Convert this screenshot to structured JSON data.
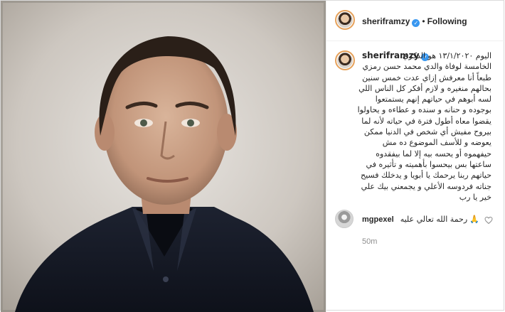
{
  "header": {
    "username": "sheriframzy",
    "verified_mark": "✓",
    "separator": "•",
    "follow_status": "Following"
  },
  "post": {
    "caption_username": "sheriframzy",
    "caption_lines": [
      "اليوم ١٣/١/٢٠٢٠ هو الذكري",
      "الخامسة لوفاة والدي محمد حسن رمزي",
      "طبعاً أنا معرفش إزاي عدت خمس سنين",
      "بحالهم منغيره و لازم أفكر كل الناس اللي",
      "لسه أبوهم في حياتهم إنهم يستمتعوا",
      "بوجوده و حنانه و سنده و عطاءه و يحاولوا",
      "يقضوا معاه أطول فترة في حياته لأنه لما",
      "بيروح مفيش أي شخص في الدنيا ممكن",
      "يعوضه و للأسف الموضوع ده مش",
      "حيفهموه أو يحسه بيه إلا لما بيفقدوه",
      "ساعتها بس بيحسوا بأهميته و تأثيره في",
      "حياتهم ربنا يرحمك يا أبويا و يدخلك فسيح",
      "جناته فردوسه الأعلي و يجمعني بيك علي",
      "خير يا رب"
    ],
    "timestamp": "50m"
  },
  "comments": [
    {
      "username": "mgpexel",
      "text": "رحمة الله تعالي عليه",
      "emoji": "🙏"
    }
  ],
  "icons": {
    "heart": "heart-icon",
    "verified": "verified-badge-icon"
  },
  "colors": {
    "verified_blue": "#3897f0",
    "story_ring": "#e6a15a",
    "text": "#262626",
    "muted": "#8e8e8e"
  }
}
